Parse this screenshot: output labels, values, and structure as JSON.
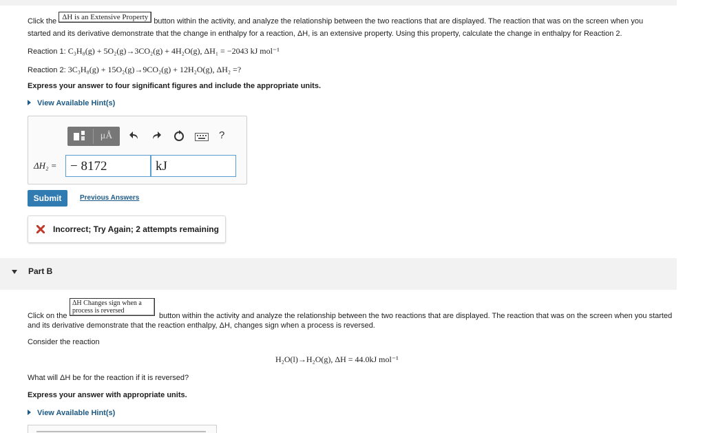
{
  "part_a": {
    "intro_before": "Click the",
    "inline_button": "ΔH is an Extensive Property",
    "intro_after_line1": "button within the activity, and analyze the relationship between the two reactions that are displayed. The reaction that was on the screen when you",
    "intro_line2": "started and its derivative demonstrate that the change in enthalpy for a reaction, ΔH, is an extensive property. Using this property, calculate the change in enthalpy for Reaction 2.",
    "reaction1_label": "Reaction 1:",
    "reaction1": "C₃H₈(g) + 5O₂(g)→3CO₂(g) + 4H₂O(g), ΔH₁ = −2043 kJ mol⁻¹",
    "reaction2_label": "Reaction 2:",
    "reaction2": "3C₃H₈(g) + 15O₂(g)→9CO₂(g) + 12H₂O(g), ΔH₂ =?",
    "instruction": "Express your answer to four significant figures and include the appropriate units.",
    "hint_link": "View Available Hint(s)",
    "answer_label": "ΔH₂ =",
    "value": "− 8172",
    "units": "kJ",
    "submit": "Submit",
    "previous_answers": "Previous Answers",
    "feedback": "Incorrect; Try Again; 2 attempts remaining",
    "toolbar": {
      "templates_icon": "templates-icon",
      "units_label": "μÅ",
      "undo_icon": "undo-icon",
      "redo_icon": "redo-icon",
      "reset_icon": "reset-icon",
      "keyboard_icon": "keyboard-icon",
      "help": "?"
    }
  },
  "part_b": {
    "header": "Part B",
    "inline_button_line1": "ΔH Changes sign when a",
    "inline_button_line2": "process is reversed",
    "intro_before": "Click on the",
    "intro_after_line1": "button within the activity and analyze the relationship between the two reactions that are displayed. The reaction that was on the screen when you started",
    "intro_line2": "and its derivative demonstrate that the reaction enthalpy, ΔH, changes sign when a process is reversed.",
    "consider": "Consider the reaction",
    "reaction": "H₂O(l)→H₂O(g), ΔH = 44.0kJ mol⁻¹",
    "question": "What will ΔH be for the reaction if it is reversed?",
    "instruction": "Express your answer with appropriate units.",
    "hint_link": "View Available Hint(s)"
  },
  "colors": {
    "link": "#1c5a86",
    "submit_bg": "#2f7bb2",
    "field_border": "#5a9ed1",
    "error_x": "#c0392b",
    "toolbar_bg": "#777777"
  }
}
